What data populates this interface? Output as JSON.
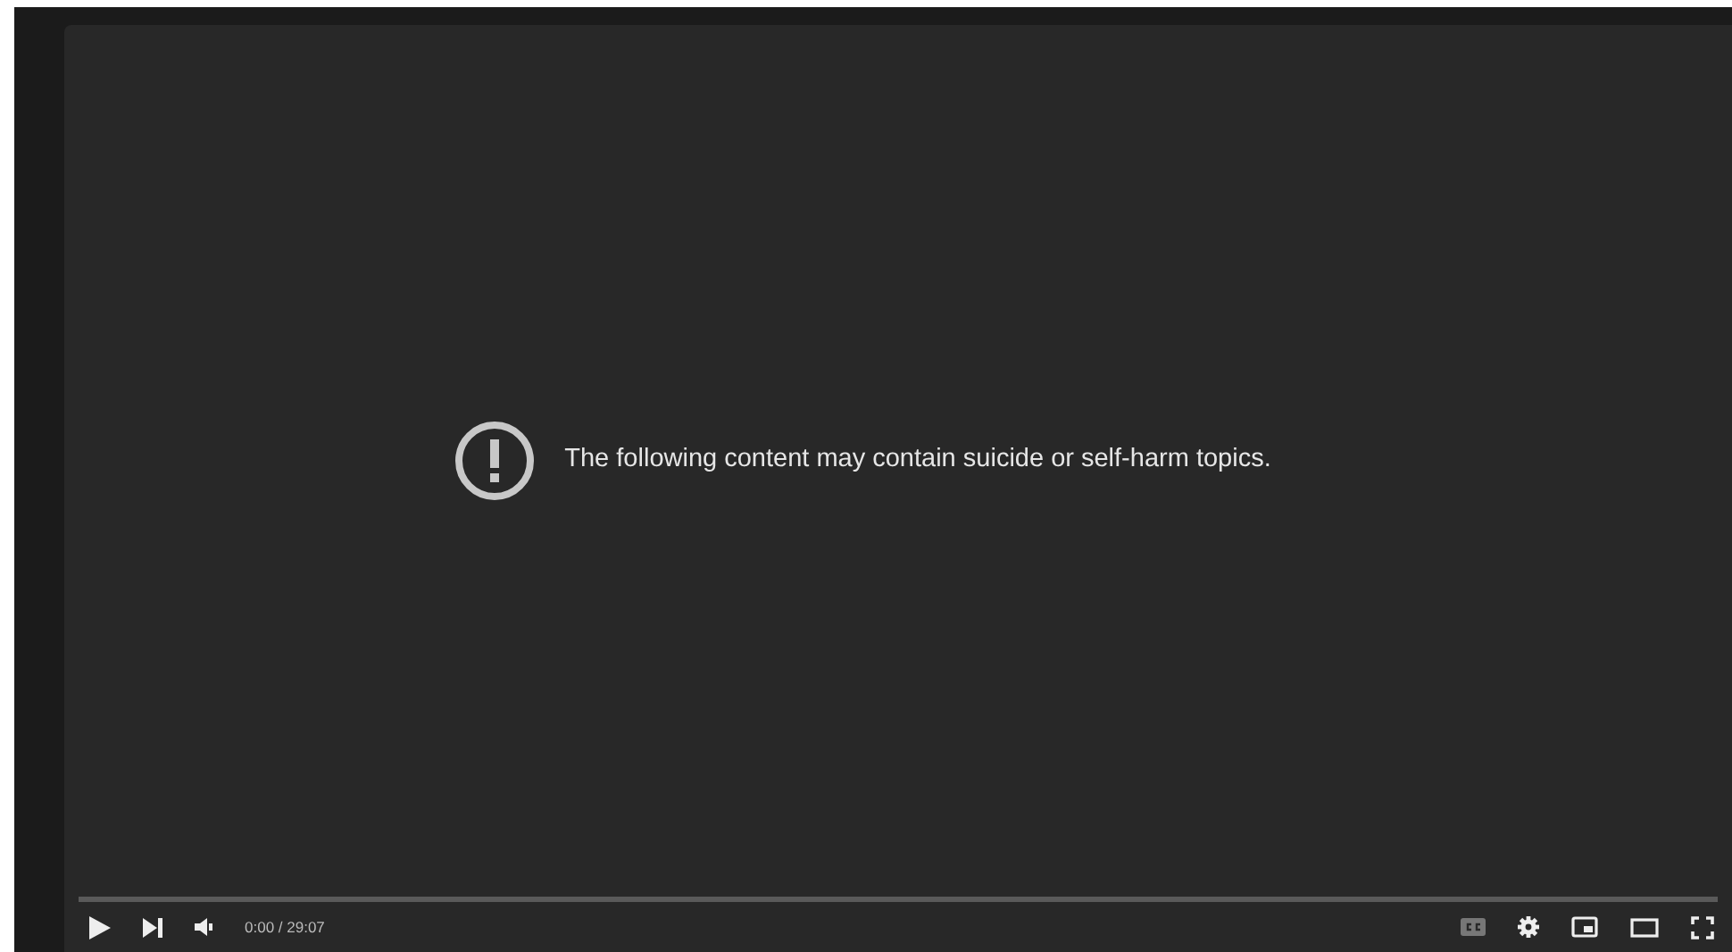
{
  "notice": {
    "text": "The following content may contain suicide or self-harm topics."
  },
  "player": {
    "progress": {
      "level": 0
    },
    "time": "0:00 / 29:07",
    "captions": {
      "on": false
    }
  }
}
